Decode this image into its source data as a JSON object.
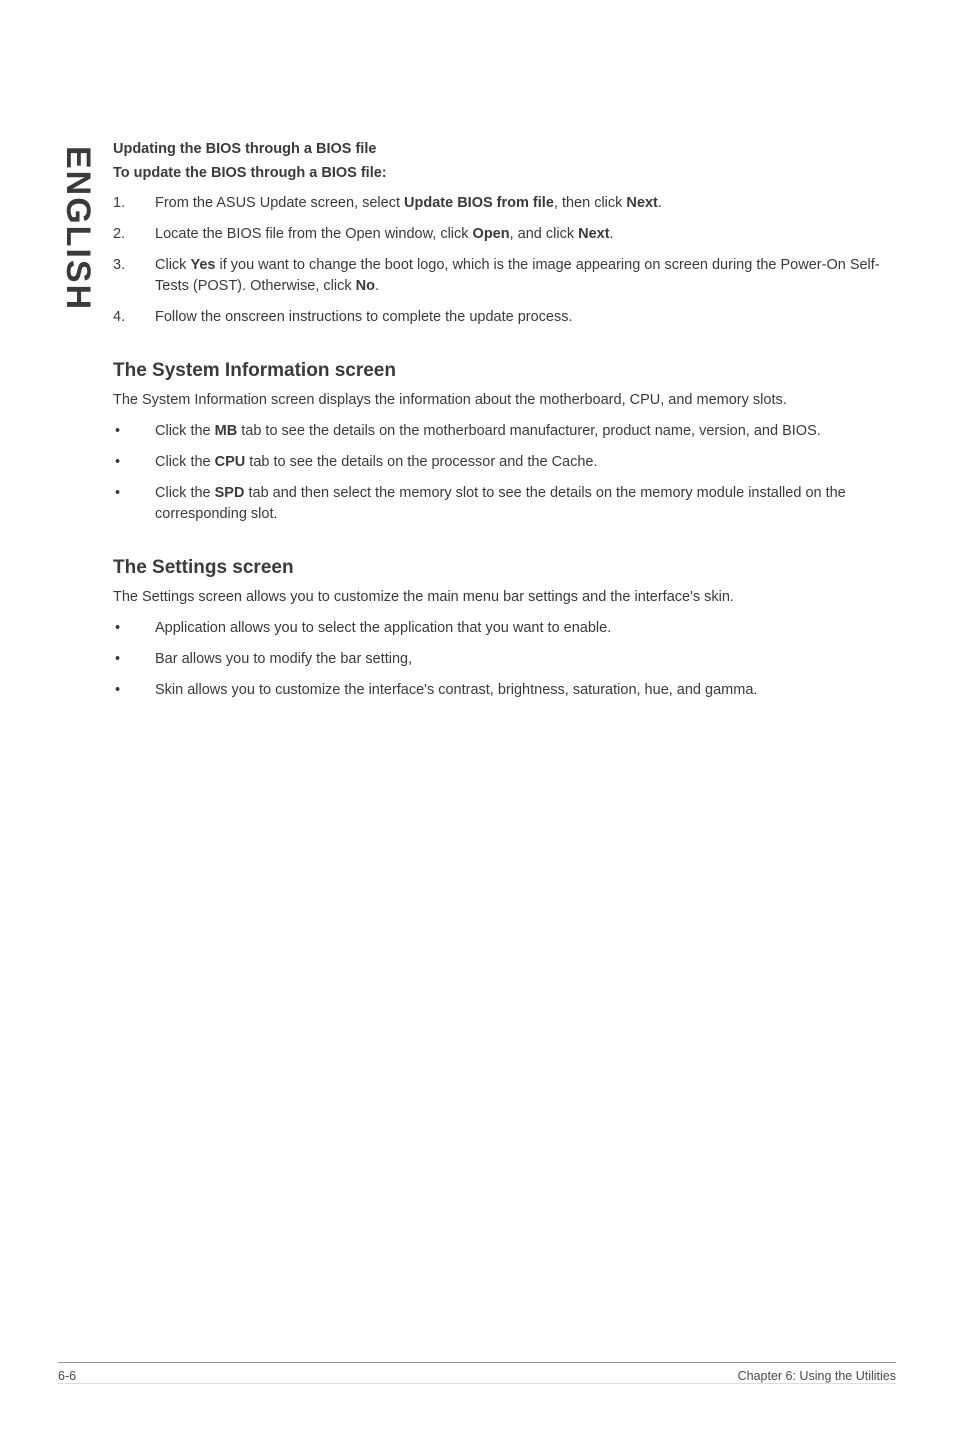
{
  "sideTab": "ENGLISH",
  "section1": {
    "title": "Updating the BIOS through a BIOS file",
    "subtitle": "To update the BIOS through a BIOS file:",
    "items": [
      {
        "num": "1.",
        "pre": "From the ASUS Update screen, select ",
        "bold1": "Update BIOS from file",
        "mid": ", then click ",
        "bold2": "Next",
        "post": "."
      },
      {
        "num": "2.",
        "pre": "Locate the BIOS file from the Open window, click ",
        "bold1": "Open",
        "mid": ", and click ",
        "bold2": "Next",
        "post": "."
      },
      {
        "num": "3.",
        "pre": "Click ",
        "bold1": "Yes",
        "mid": " if you want to change the boot logo, which is the image appearing on screen during the Power-On Self-Tests (POST). Otherwise, click ",
        "bold2": "No",
        "post": "."
      },
      {
        "num": "4.",
        "pre": "Follow the onscreen instructions to complete the update process.",
        "bold1": "",
        "mid": "",
        "bold2": "",
        "post": ""
      }
    ]
  },
  "section2": {
    "heading": "The System Information screen",
    "intro": "The System Information screen displays the information about the motherboard, CPU, and memory slots.",
    "items": [
      {
        "pre": "Click the ",
        "bold": "MB",
        "post": " tab to see the details on the motherboard manufacturer, product name, version, and BIOS."
      },
      {
        "pre": "Click the ",
        "bold": "CPU",
        "post": " tab to see the details on the processor and the Cache."
      },
      {
        "pre": "Click the ",
        "bold": "SPD",
        "post": " tab and then select the memory slot to see the details on the memory module installed on the corresponding slot."
      }
    ]
  },
  "section3": {
    "heading": "The Settings screen",
    "intro": "The Settings screen allows you to customize the main menu bar settings and the interface's skin.",
    "items": [
      {
        "text": "Application allows you to select the application that you want to enable."
      },
      {
        "text": "Bar allows you to modify the bar setting,"
      },
      {
        "text": "Skin allows you to customize the interface's contrast, brightness, saturation, hue, and gamma."
      }
    ]
  },
  "footer": {
    "left": "6-6",
    "right": "Chapter 6: Using the Utilities"
  }
}
